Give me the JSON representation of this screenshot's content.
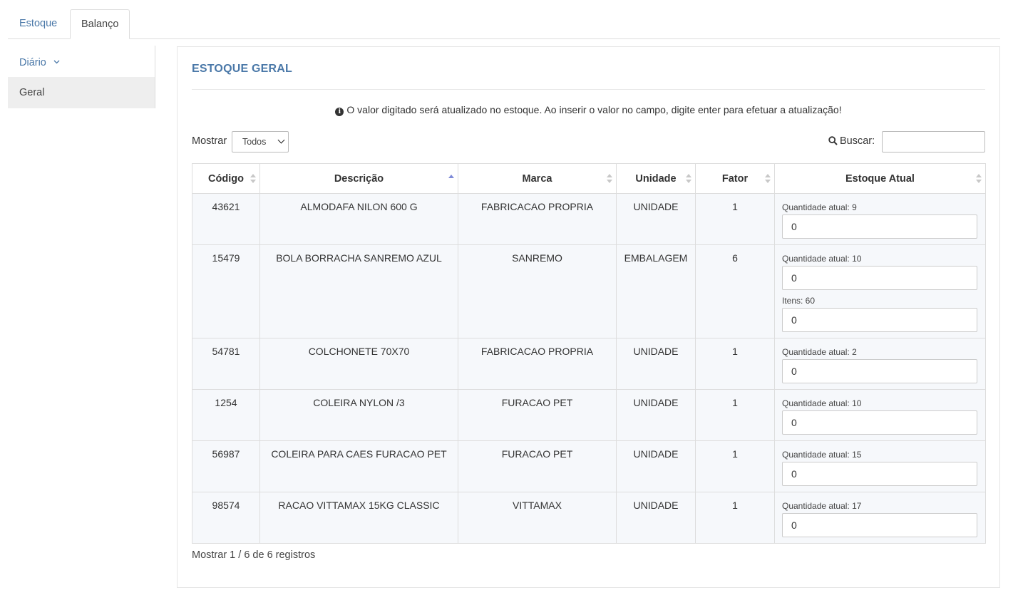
{
  "tabs": [
    {
      "label": "Estoque"
    },
    {
      "label": "Balanço"
    }
  ],
  "sidebar": {
    "items": [
      {
        "label": "Diário"
      },
      {
        "label": "Geral"
      }
    ]
  },
  "panel": {
    "title": "ESTOQUE GERAL",
    "info_text": "O valor digitado será atualizado no estoque. Ao inserir o valor no campo, digite enter para efetuar a atualização!",
    "show_label": "Mostrar",
    "show_selected": "Todos",
    "search_label": "Buscar:",
    "search_value": "",
    "footer": "Mostrar 1 / 6 de 6 registros"
  },
  "table": {
    "headers": [
      "Código",
      "Descrição",
      "Marca",
      "Unidade",
      "Fator",
      "Estoque Atual"
    ],
    "rows": [
      {
        "codigo": "43621",
        "descricao": "ALMODAFA NILON 600 G",
        "marca": "FABRICACAO PROPRIA",
        "unidade": "UNIDADE",
        "fator": "1",
        "qtd_label": "Quantidade atual: 9",
        "qtd_value": "0"
      },
      {
        "codigo": "15479",
        "descricao": "BOLA BORRACHA SANREMO AZUL",
        "marca": "SANREMO",
        "unidade": "EMBALAGEM",
        "fator": "6",
        "qtd_label": "Quantidade atual: 10",
        "qtd_value": "0",
        "itens_label": "Itens: 60",
        "itens_value": "0"
      },
      {
        "codigo": "54781",
        "descricao": "COLCHONETE 70X70",
        "marca": "FABRICACAO PROPRIA",
        "unidade": "UNIDADE",
        "fator": "1",
        "qtd_label": "Quantidade atual: 2",
        "qtd_value": "0"
      },
      {
        "codigo": "1254",
        "descricao": "COLEIRA NYLON /3",
        "marca": "FURACAO PET",
        "unidade": "UNIDADE",
        "fator": "1",
        "qtd_label": "Quantidade atual: 10",
        "qtd_value": "0"
      },
      {
        "codigo": "56987",
        "descricao": "COLEIRA PARA CAES FURACAO PET",
        "marca": "FURACAO PET",
        "unidade": "UNIDADE",
        "fator": "1",
        "qtd_label": "Quantidade atual: 15",
        "qtd_value": "0"
      },
      {
        "codigo": "98574",
        "descricao": "RACAO VITTAMAX 15KG CLASSIC",
        "marca": "VITTAMAX",
        "unidade": "UNIDADE",
        "fator": "1",
        "qtd_label": "Quantidade atual: 17",
        "qtd_value": "0"
      }
    ]
  },
  "colors": {
    "accent": "#4a78a8",
    "sort_active": "#7e8ad8"
  },
  "icons": {
    "info": "info-circle-icon",
    "search": "search-icon",
    "sidebar_toggle": "chevron-down-icon"
  }
}
